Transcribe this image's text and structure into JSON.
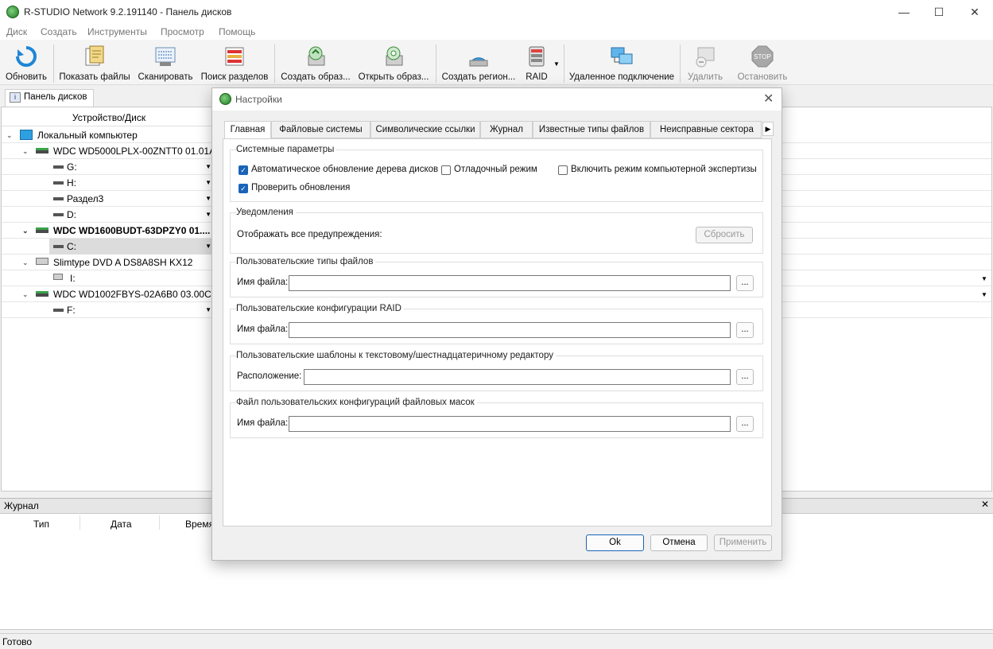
{
  "window": {
    "title": "R-STUDIO Network 9.2.191140 - Панель дисков",
    "min_glyph": "—",
    "max_glyph": "☐",
    "close_glyph": "✕"
  },
  "menu": [
    "Диск",
    "Создать",
    "Инструменты",
    "Просмотр",
    "Помощь"
  ],
  "toolbar": [
    {
      "label": "Обновить",
      "icon": "refresh-icon",
      "enabled": true
    },
    {
      "label": "Показать файлы",
      "icon": "show-files-icon",
      "enabled": true
    },
    {
      "label": "Сканировать",
      "icon": "scan-icon",
      "enabled": true
    },
    {
      "label": "Поиск разделов",
      "icon": "find-partitions-icon",
      "enabled": true
    },
    {
      "label": "Создать образ...",
      "icon": "create-image-icon",
      "enabled": true
    },
    {
      "label": "Открыть образ...",
      "icon": "open-image-icon",
      "enabled": true
    },
    {
      "label": "Создать регион...",
      "icon": "create-region-icon",
      "enabled": true
    },
    {
      "label": "RAID",
      "icon": "raid-icon",
      "enabled": true
    },
    {
      "label": "Удаленное подключение",
      "icon": "remote-connect-icon",
      "enabled": true
    },
    {
      "label": "Удалить",
      "icon": "delete-icon",
      "enabled": false
    },
    {
      "label": "Остановить",
      "icon": "stop-icon",
      "enabled": false
    }
  ],
  "stop_text": "STOP",
  "panel_tab": "Панель дисков",
  "tree": {
    "header": "Устройство/Диск",
    "rows": [
      {
        "label": "Локальный компьютер"
      },
      {
        "label": "WDC WD5000LPLX-00ZNTT0 01.01A01"
      },
      {
        "label": "G:"
      },
      {
        "label": "H:"
      },
      {
        "label": "Раздел3"
      },
      {
        "label": "D:"
      },
      {
        "label": "WDC WD1600BUDT-63DPZY0 01...."
      },
      {
        "label": "C:"
      },
      {
        "label": "Slimtype DVD A DS8A8SH KX12"
      },
      {
        "label": "I:"
      },
      {
        "label": "WDC WD1002FBYS-02A6B0 03.00C06"
      },
      {
        "label": "F:"
      }
    ]
  },
  "journal": {
    "title": "Журнал",
    "columns": [
      "Тип",
      "Дата",
      "Время"
    ]
  },
  "status": "Готово",
  "dialog": {
    "title": "Настройки",
    "tabs": [
      "Главная",
      "Файловые системы",
      "Символические ссылки",
      "Журнал",
      "Известные типы файлов",
      "Неисправные сектора"
    ],
    "active_tab": "Главная",
    "system": {
      "title": "Системные параметры",
      "auto_update": {
        "label": "Автоматическое обновление дерева дисков",
        "checked": true
      },
      "debug": {
        "label": "Отладочный режим",
        "checked": false
      },
      "forensic": {
        "label": "Включить режим компьютерной экспертизы",
        "checked": false
      },
      "check_updates": {
        "label": "Проверить обновления",
        "checked": true
      }
    },
    "notifications": {
      "title": "Уведомления",
      "show_warnings": "Отображать все предупреждения:",
      "reset": "Сбросить"
    },
    "user_file_types": {
      "title": "Пользовательские типы файлов",
      "field_label": "Имя файла:",
      "value": ""
    },
    "user_raid": {
      "title": "Пользовательские конфигурации RAID",
      "field_label": "Имя файла:",
      "value": ""
    },
    "templates": {
      "title": "Пользовательские шаблоны к текстовому/шестнадцатеричному редактору",
      "field_label": "Расположение:",
      "value": ""
    },
    "file_masks": {
      "title": "Файл пользовательских конфигураций файловых масок",
      "field_label": "Имя файла:",
      "value": ""
    },
    "browse_label": "...",
    "ok": "Ok",
    "cancel": "Отмена",
    "apply": "Применить"
  }
}
